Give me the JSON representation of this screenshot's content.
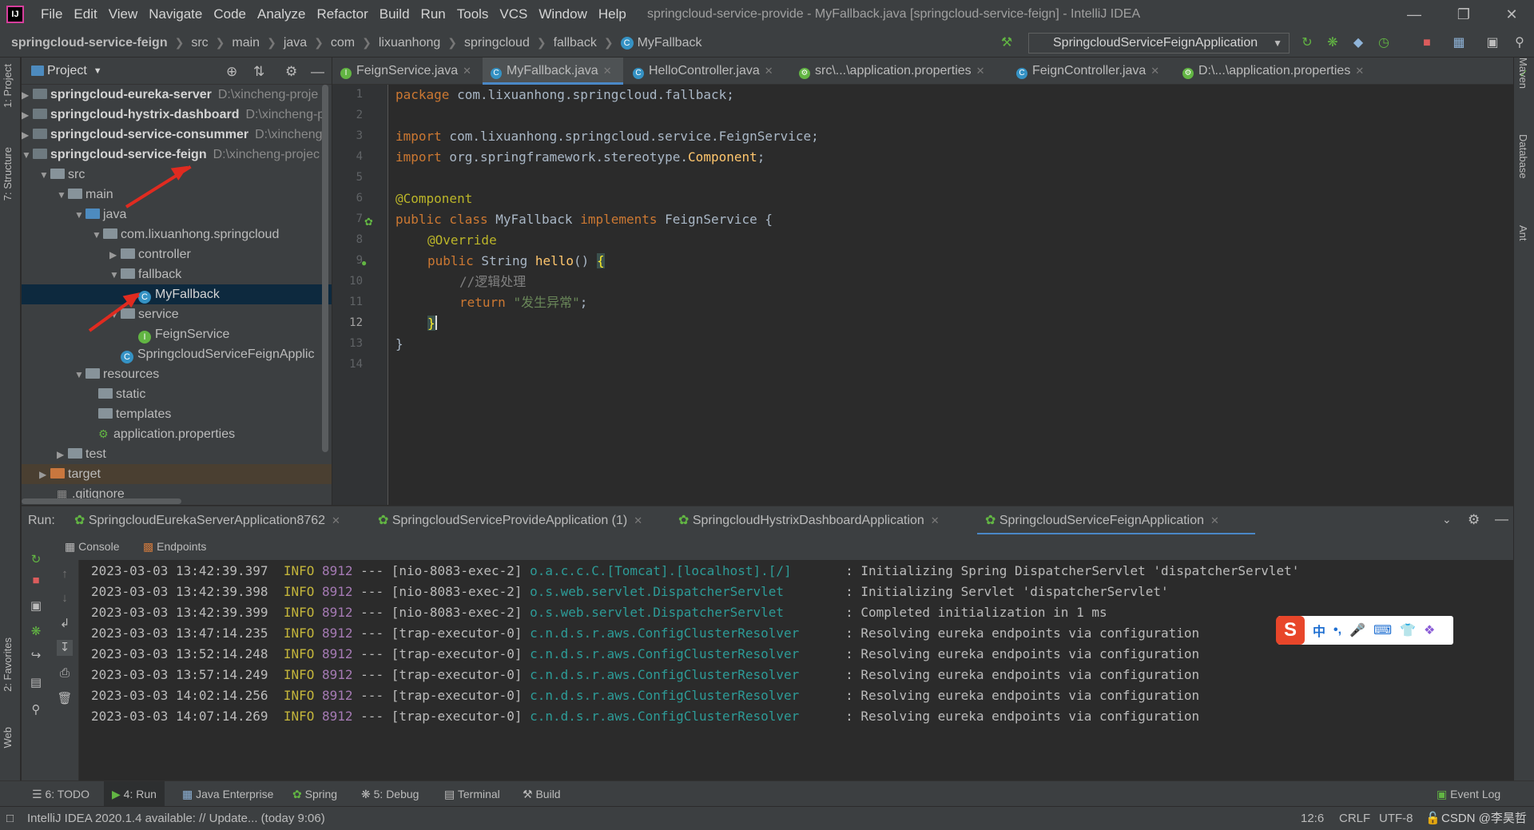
{
  "menu": {
    "items": [
      "File",
      "Edit",
      "View",
      "Navigate",
      "Code",
      "Analyze",
      "Refactor",
      "Build",
      "Run",
      "Tools",
      "VCS",
      "Window",
      "Help"
    ],
    "window_title": "springcloud-service-provide - MyFallback.java [springcloud-service-feign] - IntelliJ IDEA"
  },
  "breadcrumb": [
    "springcloud-service-feign",
    "src",
    "main",
    "java",
    "com",
    "lixuanhong",
    "springcloud",
    "fallback",
    "MyFallback"
  ],
  "run_config": "SpringcloudServiceFeignApplication",
  "left_strip": {
    "project_tab": "1: Project",
    "structure_tab": "7: Structure",
    "favorites_tab": "2: Favorites",
    "web_tab": "Web"
  },
  "right_strip": {
    "maven_tab": "Maven",
    "database_tab": "Database",
    "ant_tab": "Ant"
  },
  "project": {
    "header": "Project",
    "tree": [
      {
        "label": "springcloud-eureka-server",
        "path": "D:\\xincheng-proje",
        "bold": true
      },
      {
        "label": "springcloud-hystrix-dashboard",
        "path": "D:\\xincheng-p",
        "bold": true
      },
      {
        "label": "springcloud-service-consummer",
        "path": "D:\\xincheng",
        "bold": true
      },
      {
        "label": "springcloud-service-feign",
        "path": "D:\\xincheng-projec",
        "bold": true
      },
      {
        "label": "src"
      },
      {
        "label": "main"
      },
      {
        "label": "java"
      },
      {
        "label": "com.lixuanhong.springcloud"
      },
      {
        "label": "controller"
      },
      {
        "label": "fallback"
      },
      {
        "label": "MyFallback"
      },
      {
        "label": "service"
      },
      {
        "label": "FeignService"
      },
      {
        "label": "SpringcloudServiceFeignApplic"
      },
      {
        "label": "resources"
      },
      {
        "label": "static"
      },
      {
        "label": "templates"
      },
      {
        "label": "application.properties"
      },
      {
        "label": "test"
      },
      {
        "label": "target"
      },
      {
        "label": ".gitignore"
      }
    ]
  },
  "editor": {
    "tabs": [
      {
        "label": "FeignService.java"
      },
      {
        "label": "MyFallback.java"
      },
      {
        "label": "HelloController.java"
      },
      {
        "label": "src\\...\\application.properties"
      },
      {
        "label": "FeignController.java"
      },
      {
        "label": "D:\\...\\application.properties"
      }
    ],
    "line_numbers": [
      "1",
      "2",
      "3",
      "4",
      "5",
      "6",
      "7",
      "8",
      "9",
      "10",
      "11",
      "12",
      "13",
      "14"
    ],
    "code": {
      "l1_kw": "package",
      "l1_rest": " com.lixuanhong.springcloud.fallback;",
      "l3_kw": "import",
      "l3_rest": " com.lixuanhong.springcloud.service.FeignService;",
      "l4_kw": "import",
      "l4_rest": " org.springframework.stereotype.",
      "l4_cls": "Component",
      "l4_end": ";",
      "l6_ann": "@Component",
      "l7_kw1": "public class",
      "l7_name": " MyFallback ",
      "l7_kw2": "implements",
      "l7_rest": " FeignService {",
      "l8_ann": "@Override",
      "l9_kw": "public",
      "l9_type": " String ",
      "l9_fn": "hello",
      "l9_rest": "() ",
      "l9_brace": "{",
      "l10_cmt": "//逻辑处理",
      "l11_kw": "return",
      "l11_str": "\"发生异常\"",
      "l11_end": ";",
      "l12_brace": "}",
      "l13_brace": "}"
    }
  },
  "run": {
    "label": "Run:",
    "tabs": [
      {
        "label": "SpringcloudEurekaServerApplication8762"
      },
      {
        "label": "SpringcloudServiceProvideApplication (1)"
      },
      {
        "label": "SpringcloudHystrixDashboardApplication"
      },
      {
        "label": "SpringcloudServiceFeignApplication"
      }
    ],
    "subtabs": [
      "Console",
      "Endpoints"
    ],
    "log": [
      {
        "ts": "2023-03-03 13:42:39.397",
        "level": "INFO",
        "pid": "8912",
        "sep": "---",
        "thread": "[nio-8083-exec-2]",
        "logger": "o.a.c.c.C.[Tomcat].[localhost].[/]      ",
        "msg": ": Initializing Spring DispatcherServlet 'dispatcherServlet'"
      },
      {
        "ts": "2023-03-03 13:42:39.398",
        "level": "INFO",
        "pid": "8912",
        "sep": "---",
        "thread": "[nio-8083-exec-2]",
        "logger": "o.s.web.servlet.DispatcherServlet       ",
        "msg": ": Initializing Servlet 'dispatcherServlet'"
      },
      {
        "ts": "2023-03-03 13:42:39.399",
        "level": "INFO",
        "pid": "8912",
        "sep": "---",
        "thread": "[nio-8083-exec-2]",
        "logger": "o.s.web.servlet.DispatcherServlet       ",
        "msg": ": Completed initialization in 1 ms"
      },
      {
        "ts": "2023-03-03 13:47:14.235",
        "level": "INFO",
        "pid": "8912",
        "sep": "---",
        "thread": "[trap-executor-0]",
        "logger": "c.n.d.s.r.aws.ConfigClusterResolver     ",
        "msg": ": Resolving eureka endpoints via configuration"
      },
      {
        "ts": "2023-03-03 13:52:14.248",
        "level": "INFO",
        "pid": "8912",
        "sep": "---",
        "thread": "[trap-executor-0]",
        "logger": "c.n.d.s.r.aws.ConfigClusterResolver     ",
        "msg": ": Resolving eureka endpoints via configuration"
      },
      {
        "ts": "2023-03-03 13:57:14.249",
        "level": "INFO",
        "pid": "8912",
        "sep": "---",
        "thread": "[trap-executor-0]",
        "logger": "c.n.d.s.r.aws.ConfigClusterResolver     ",
        "msg": ": Resolving eureka endpoints via configuration"
      },
      {
        "ts": "2023-03-03 14:02:14.256",
        "level": "INFO",
        "pid": "8912",
        "sep": "---",
        "thread": "[trap-executor-0]",
        "logger": "c.n.d.s.r.aws.ConfigClusterResolver     ",
        "msg": ": Resolving eureka endpoints via configuration"
      },
      {
        "ts": "2023-03-03 14:07:14.269",
        "level": "INFO",
        "pid": "8912",
        "sep": "---",
        "thread": "[trap-executor-0]",
        "logger": "c.n.d.s.r.aws.ConfigClusterResolver     ",
        "msg": ": Resolving eureka endpoints via configuration"
      }
    ]
  },
  "ime": {
    "logo": "S",
    "mode": "中",
    "punct": "•,",
    "icons": [
      "mic-icon",
      "keyboard-icon",
      "shirt-icon",
      "apps-icon"
    ]
  },
  "tool_tabs": [
    {
      "label": "6: TODO"
    },
    {
      "label": "4: Run"
    },
    {
      "label": "Java Enterprise"
    },
    {
      "label": "Spring"
    },
    {
      "label": "5: Debug"
    },
    {
      "label": "Terminal"
    },
    {
      "label": "Build"
    },
    {
      "label": "Event Log"
    }
  ],
  "status": {
    "message": "IntelliJ IDEA 2020.1.4 available: // Update... (today 9:06)",
    "position": "12:6",
    "line_sep": "CRLF",
    "encoding": "UTF-8",
    "watermark": "CSDN @李昊哲"
  },
  "colors": {
    "accent": "#4a88c7",
    "selection": "#0d293e",
    "annotation_arrow": "#e02b20"
  }
}
